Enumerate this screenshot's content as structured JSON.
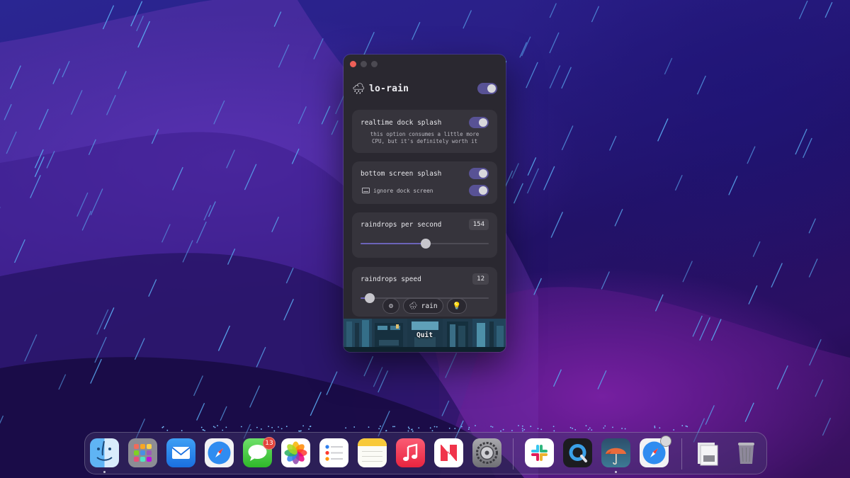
{
  "app": {
    "title": "lo-rain",
    "icon": "cloud-rain-icon",
    "enabled": true
  },
  "settings": {
    "realtime_dock_splash": {
      "label": "realtime dock splash",
      "enabled": true,
      "note_line1": "this option consumes a little more",
      "note_line2": "CPU, but it's definitely worth it"
    },
    "bottom_screen_splash": {
      "label": "bottom screen splash",
      "enabled": true,
      "ignore_dock_screen": {
        "label": "ignore dock screen",
        "enabled": true
      }
    },
    "raindrops_per_second": {
      "label": "raindrops per second",
      "value": "154",
      "level": 0.51
    },
    "raindrops_speed": {
      "label": "raindrops speed",
      "value": "12",
      "level": 0.07
    }
  },
  "bottom_tabs": [
    {
      "icon": "gear-icon",
      "label": ""
    },
    {
      "icon": "cloud-rain-icon",
      "label": "rain"
    },
    {
      "icon": "lightbulb-icon",
      "label": ""
    }
  ],
  "quit_label": "Quit",
  "dock": {
    "items": [
      {
        "name": "finder",
        "running": true
      },
      {
        "name": "launchpad",
        "running": false
      },
      {
        "name": "mail",
        "running": false
      },
      {
        "name": "safari",
        "running": false
      },
      {
        "name": "messages",
        "running": false,
        "badge": "13"
      },
      {
        "name": "photos",
        "running": false
      },
      {
        "name": "reminders",
        "running": false
      },
      {
        "name": "notes",
        "running": false
      },
      {
        "name": "music",
        "running": false
      },
      {
        "name": "news",
        "running": false
      },
      {
        "name": "system-settings",
        "running": false
      },
      {
        "name": "slack",
        "running": false
      },
      {
        "name": "quicktime",
        "running": false
      },
      {
        "name": "lo-rain",
        "running": true
      },
      {
        "name": "safari-web-app",
        "running": false
      },
      {
        "name": "downloads-folder",
        "running": false
      },
      {
        "name": "trash",
        "running": false
      }
    ]
  },
  "colors": {
    "accent": "#585295",
    "window_bg": "#2a2830",
    "card_bg": "#36343c",
    "rain": "#5aa8f0"
  }
}
